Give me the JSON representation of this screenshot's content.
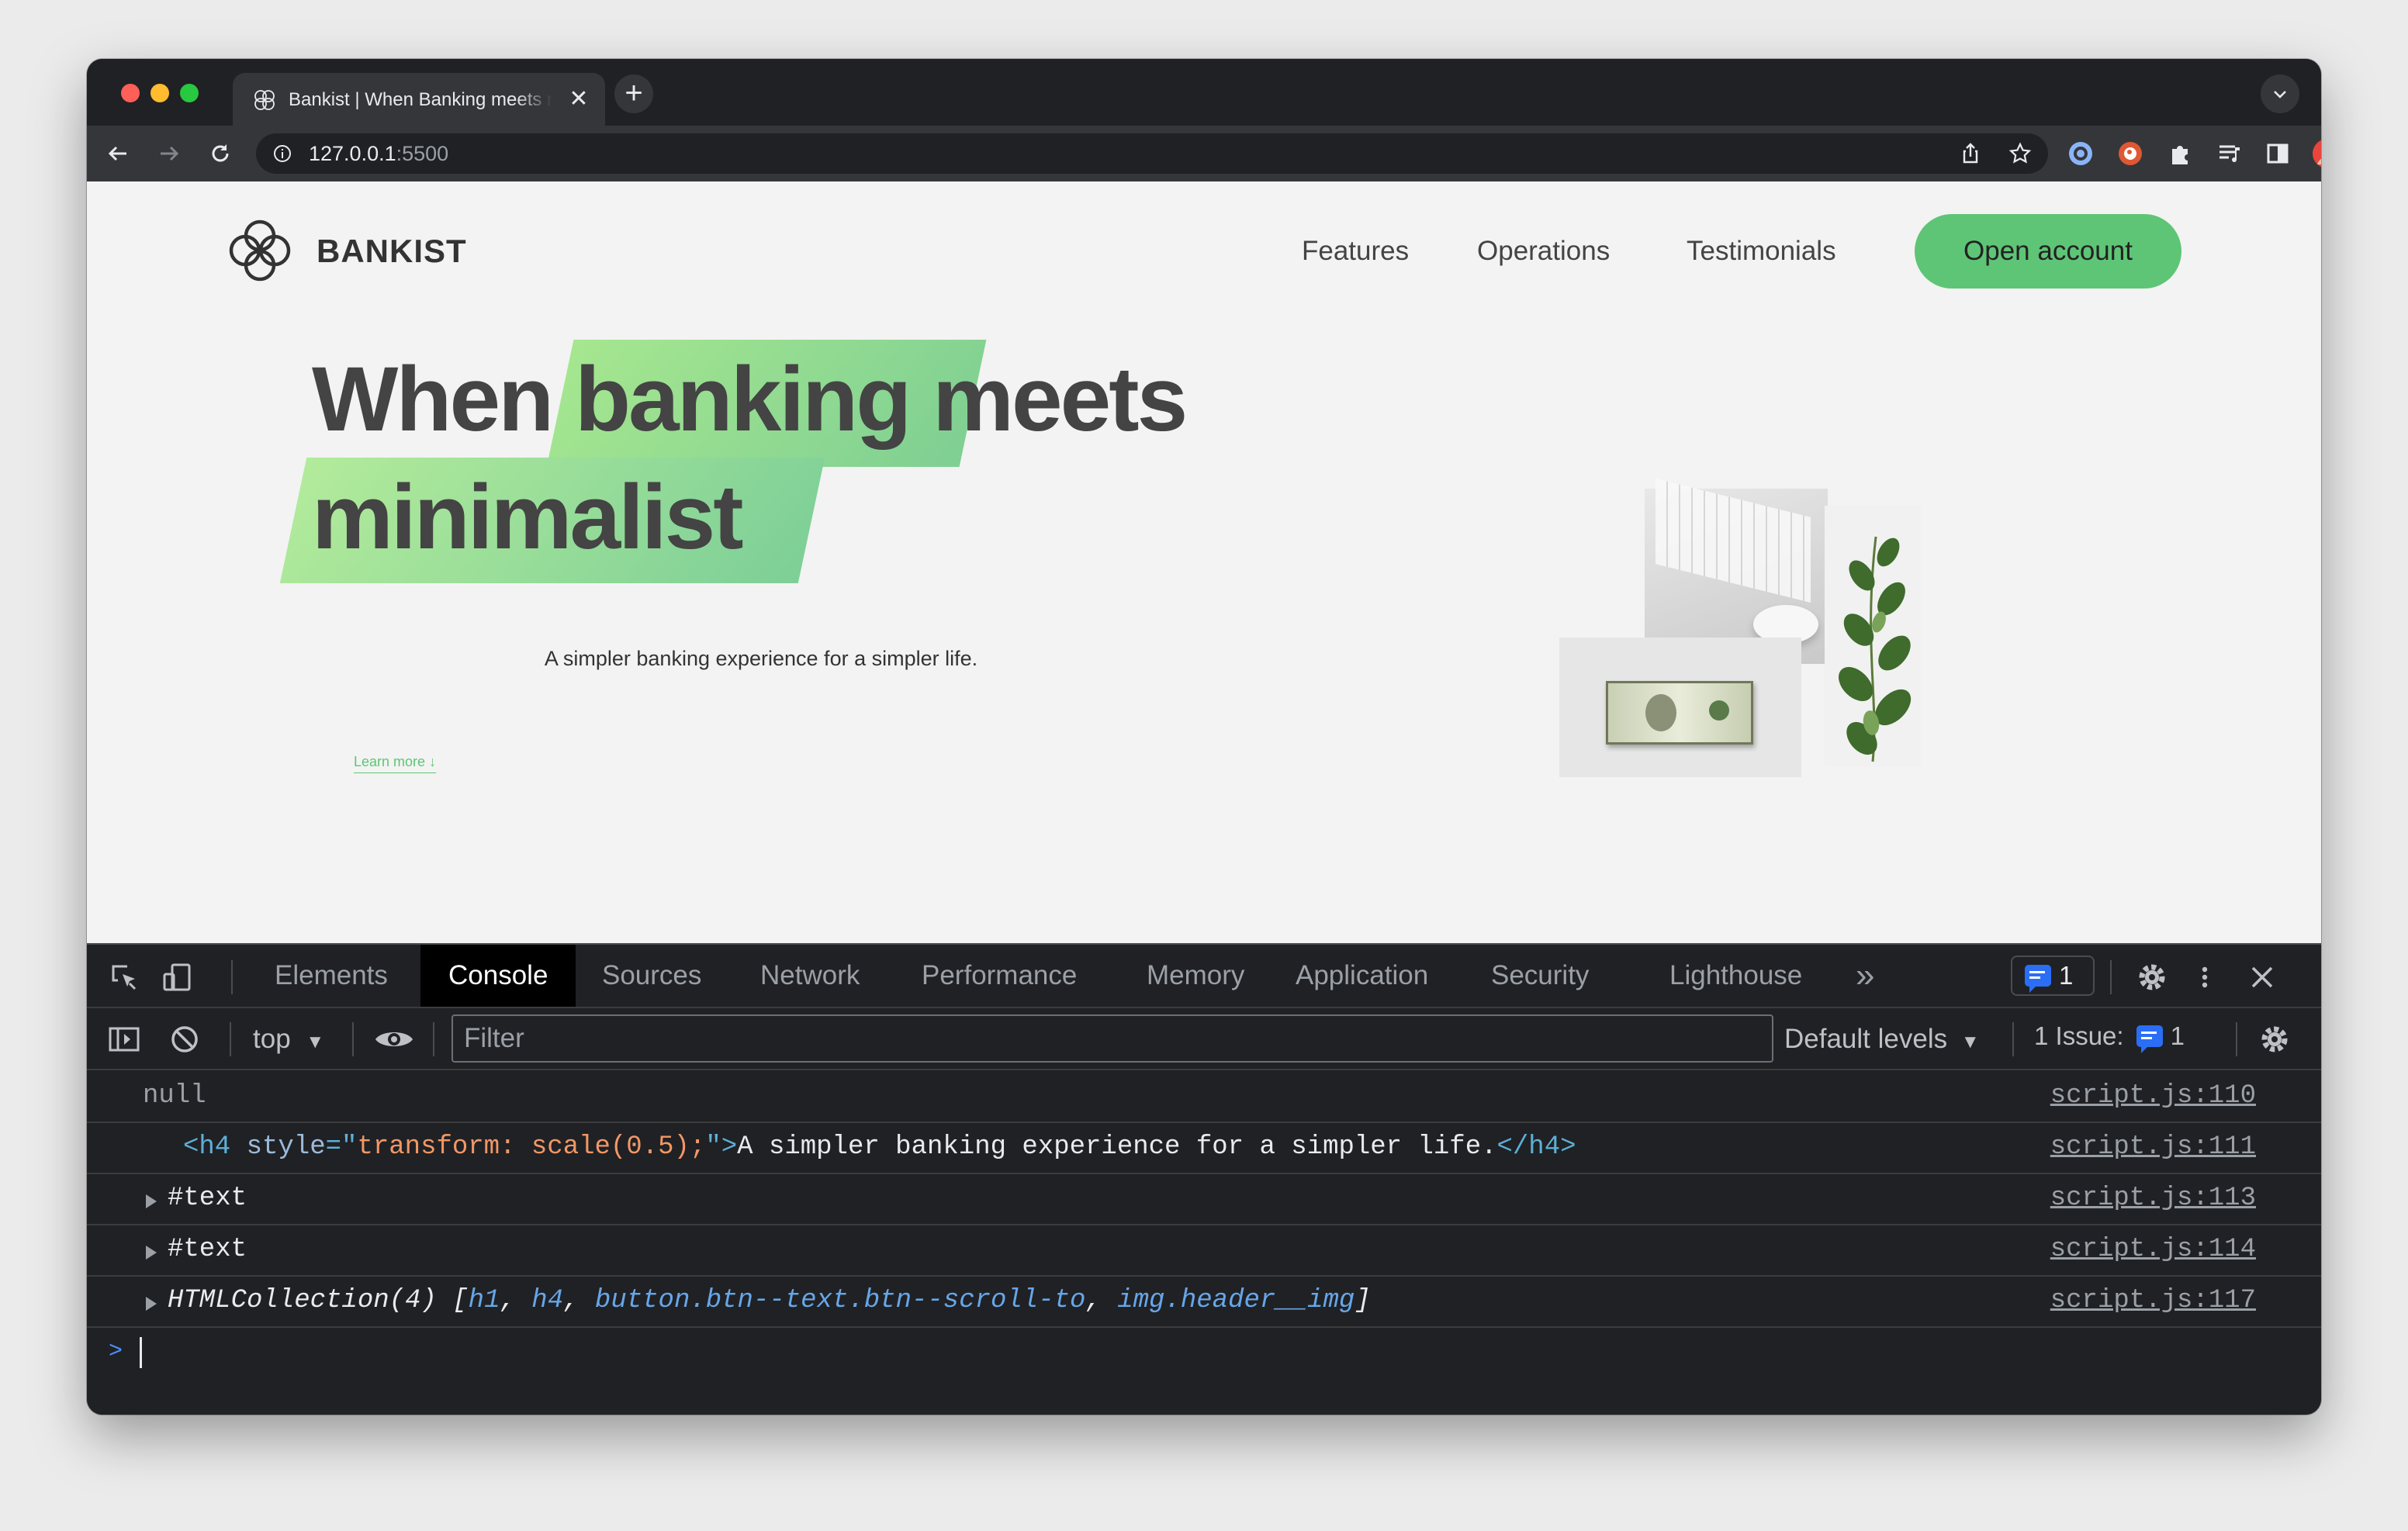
{
  "browser": {
    "tab_title": "Bankist | When Banking meets minimalist",
    "tab_close": "✕",
    "new_tab": "+",
    "url_host": "127.0.0.1",
    "url_port": ":5500"
  },
  "site": {
    "logo_text": "BANKIST",
    "nav": [
      "Features",
      "Operations",
      "Testimonials"
    ],
    "cta": "Open account",
    "headline_1": "When",
    "headline_2": "banking",
    "headline_3": "meets",
    "headline_4": "minimalist",
    "subtitle": "A simpler banking experience for a simpler life.",
    "learn_more": "Learn more ↓"
  },
  "devtools": {
    "tabs": [
      "Elements",
      "Console",
      "Sources",
      "Network",
      "Performance",
      "Memory",
      "Application",
      "Security",
      "Lighthouse"
    ],
    "active_tab": "Console",
    "more": "»",
    "messages_count": "1",
    "context": "top",
    "filter_placeholder": "Filter",
    "levels": "Default levels",
    "issues_label": "1 Issue:",
    "issues_count": "1",
    "console_rows": [
      {
        "expandable": false,
        "indent": 0,
        "parts": [
          {
            "t": "null",
            "c": "t-null"
          }
        ],
        "source": "script.js:110"
      },
      {
        "expandable": false,
        "indent": 1,
        "parts": [
          {
            "t": "<h4",
            "c": "t-tag"
          },
          {
            "t": " style",
            "c": "t-attr"
          },
          {
            "t": "=\"",
            "c": "t-tag"
          },
          {
            "t": "transform: scale(0.5);",
            "c": "t-val"
          },
          {
            "t": "\">",
            "c": "t-tag"
          },
          {
            "t": "A simpler banking experience for a simpler life.",
            "c": ""
          },
          {
            "t": "</h4>",
            "c": "t-tag"
          }
        ],
        "source": "script.js:111"
      },
      {
        "expandable": true,
        "indent": 0,
        "parts": [
          {
            "t": "#text",
            "c": ""
          }
        ],
        "source": "script.js:113"
      },
      {
        "expandable": true,
        "indent": 0,
        "parts": [
          {
            "t": "#text",
            "c": ""
          }
        ],
        "source": "script.js:114"
      },
      {
        "expandable": true,
        "indent": 0,
        "parts": [
          {
            "t": "HTMLCollection(4) [",
            "c": "t-ital"
          },
          {
            "t": "h1",
            "c": "t-cls"
          },
          {
            "t": ", ",
            "c": "t-ital"
          },
          {
            "t": "h4",
            "c": "t-cls"
          },
          {
            "t": ", ",
            "c": "t-ital"
          },
          {
            "t": "button.btn--text.btn--scroll-to",
            "c": "t-cls"
          },
          {
            "t": ", ",
            "c": "t-ital"
          },
          {
            "t": "img.header__img",
            "c": "t-cls"
          },
          {
            "t": "]",
            "c": "t-ital"
          }
        ],
        "source": "script.js:117"
      }
    ],
    "prompt": ">"
  },
  "colors": {
    "accent_green": "#5ec576",
    "devtools_bg": "#202124",
    "link_blue": "#4d90fe"
  }
}
